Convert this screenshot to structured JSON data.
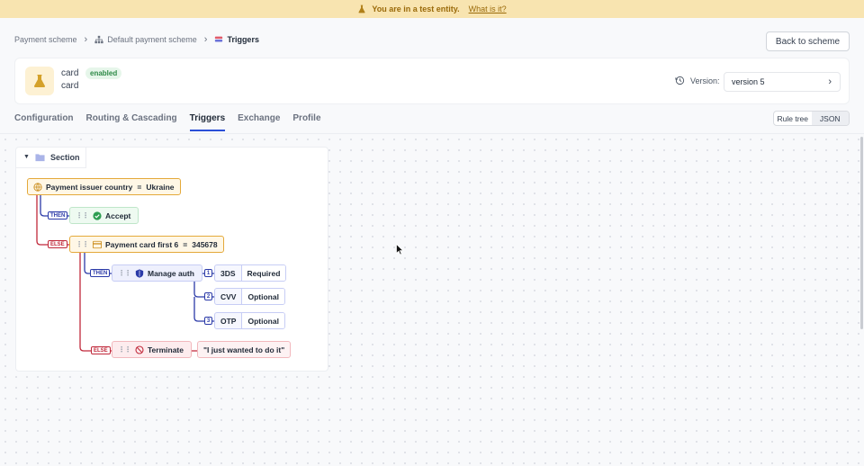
{
  "banner": {
    "text": "You are in a test entity.",
    "link": "What is it?"
  },
  "breadcrumb": {
    "root": "Payment scheme",
    "scheme": "Default payment scheme",
    "current": "Triggers"
  },
  "back_button": "Back to scheme",
  "entity": {
    "name": "card",
    "status": "enabled",
    "subtitle": "card"
  },
  "version": {
    "label": "Version:",
    "value": "version 5"
  },
  "tabs": [
    "Configuration",
    "Routing & Cascading",
    "Triggers",
    "Exchange",
    "Profile"
  ],
  "active_tab": "Triggers",
  "view_toggle": {
    "rule_tree": "Rule tree",
    "json": "JSON"
  },
  "tree": {
    "section": "Section",
    "cond1": {
      "field": "Payment issuer country",
      "value": "Ukraine"
    },
    "accept": "Accept",
    "cond2": {
      "field": "Payment card first 6",
      "value": "345678"
    },
    "auth": "Manage auth",
    "auth_params": [
      {
        "index": "1",
        "name": "3DS",
        "value": "Required"
      },
      {
        "index": "2",
        "name": "CVV",
        "value": "Optional"
      },
      {
        "index": "3",
        "name": "OTP",
        "value": "Optional"
      }
    ],
    "terminate": "Terminate",
    "terminate_msg": "\"I just wanted to do it\"",
    "then_label": "THEN",
    "else_label": "ELSE"
  },
  "colors": {
    "then_wire": "#2b3aa8",
    "else_wire": "#c0283a",
    "accent": "#2b4fd8"
  }
}
